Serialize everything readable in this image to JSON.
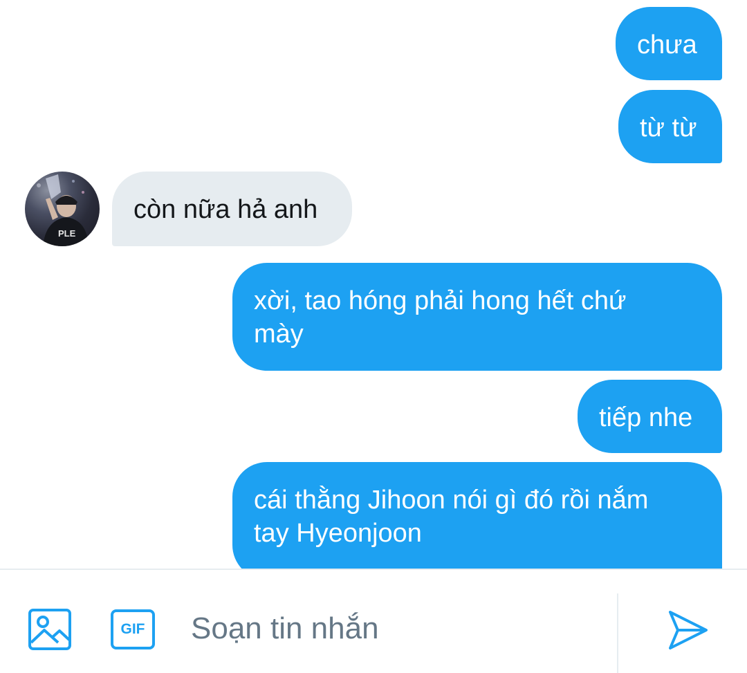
{
  "messages": [
    {
      "id": "m1",
      "direction": "outgoing",
      "text": "chưa"
    },
    {
      "id": "m2",
      "direction": "outgoing",
      "text": "từ từ"
    },
    {
      "id": "m3",
      "direction": "incoming",
      "text": "còn nữa hả anh"
    },
    {
      "id": "m4",
      "direction": "outgoing",
      "text": "xời, tao hóng phải hong hết chứ\nmày"
    },
    {
      "id": "m5",
      "direction": "outgoing",
      "text": "tiếp nhe"
    },
    {
      "id": "m6",
      "direction": "outgoing",
      "text": "cái thằng Jihoon nói gì đó rồi nắm\ntay Hyeonjoon"
    }
  ],
  "composer": {
    "image_icon": "image-icon",
    "gif_label": "GIF",
    "placeholder": "Soạn tin nhắn",
    "send_icon": "send-icon"
  },
  "colors": {
    "accent": "#1da1f2",
    "incoming_bubble": "#e6ecf0",
    "placeholder_text": "#657786"
  }
}
